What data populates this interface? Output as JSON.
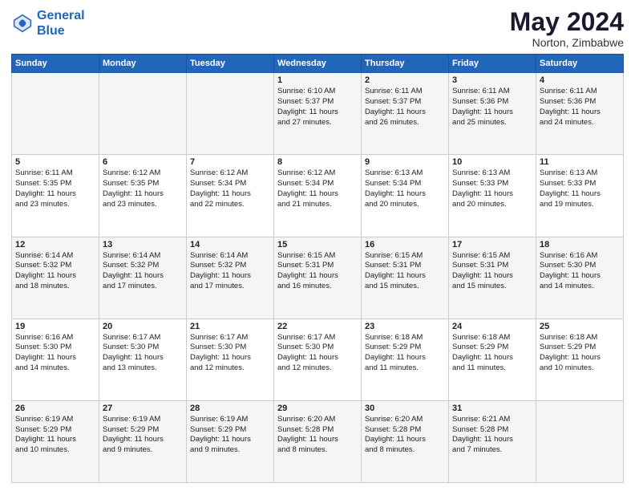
{
  "header": {
    "logo_line1": "General",
    "logo_line2": "Blue",
    "month": "May 2024",
    "location": "Norton, Zimbabwe"
  },
  "weekdays": [
    "Sunday",
    "Monday",
    "Tuesday",
    "Wednesday",
    "Thursday",
    "Friday",
    "Saturday"
  ],
  "weeks": [
    [
      {
        "day": "",
        "content": ""
      },
      {
        "day": "",
        "content": ""
      },
      {
        "day": "",
        "content": ""
      },
      {
        "day": "1",
        "content": "Sunrise: 6:10 AM\nSunset: 5:37 PM\nDaylight: 11 hours\nand 27 minutes."
      },
      {
        "day": "2",
        "content": "Sunrise: 6:11 AM\nSunset: 5:37 PM\nDaylight: 11 hours\nand 26 minutes."
      },
      {
        "day": "3",
        "content": "Sunrise: 6:11 AM\nSunset: 5:36 PM\nDaylight: 11 hours\nand 25 minutes."
      },
      {
        "day": "4",
        "content": "Sunrise: 6:11 AM\nSunset: 5:36 PM\nDaylight: 11 hours\nand 24 minutes."
      }
    ],
    [
      {
        "day": "5",
        "content": "Sunrise: 6:11 AM\nSunset: 5:35 PM\nDaylight: 11 hours\nand 23 minutes."
      },
      {
        "day": "6",
        "content": "Sunrise: 6:12 AM\nSunset: 5:35 PM\nDaylight: 11 hours\nand 23 minutes."
      },
      {
        "day": "7",
        "content": "Sunrise: 6:12 AM\nSunset: 5:34 PM\nDaylight: 11 hours\nand 22 minutes."
      },
      {
        "day": "8",
        "content": "Sunrise: 6:12 AM\nSunset: 5:34 PM\nDaylight: 11 hours\nand 21 minutes."
      },
      {
        "day": "9",
        "content": "Sunrise: 6:13 AM\nSunset: 5:34 PM\nDaylight: 11 hours\nand 20 minutes."
      },
      {
        "day": "10",
        "content": "Sunrise: 6:13 AM\nSunset: 5:33 PM\nDaylight: 11 hours\nand 20 minutes."
      },
      {
        "day": "11",
        "content": "Sunrise: 6:13 AM\nSunset: 5:33 PM\nDaylight: 11 hours\nand 19 minutes."
      }
    ],
    [
      {
        "day": "12",
        "content": "Sunrise: 6:14 AM\nSunset: 5:32 PM\nDaylight: 11 hours\nand 18 minutes."
      },
      {
        "day": "13",
        "content": "Sunrise: 6:14 AM\nSunset: 5:32 PM\nDaylight: 11 hours\nand 17 minutes."
      },
      {
        "day": "14",
        "content": "Sunrise: 6:14 AM\nSunset: 5:32 PM\nDaylight: 11 hours\nand 17 minutes."
      },
      {
        "day": "15",
        "content": "Sunrise: 6:15 AM\nSunset: 5:31 PM\nDaylight: 11 hours\nand 16 minutes."
      },
      {
        "day": "16",
        "content": "Sunrise: 6:15 AM\nSunset: 5:31 PM\nDaylight: 11 hours\nand 15 minutes."
      },
      {
        "day": "17",
        "content": "Sunrise: 6:15 AM\nSunset: 5:31 PM\nDaylight: 11 hours\nand 15 minutes."
      },
      {
        "day": "18",
        "content": "Sunrise: 6:16 AM\nSunset: 5:30 PM\nDaylight: 11 hours\nand 14 minutes."
      }
    ],
    [
      {
        "day": "19",
        "content": "Sunrise: 6:16 AM\nSunset: 5:30 PM\nDaylight: 11 hours\nand 14 minutes."
      },
      {
        "day": "20",
        "content": "Sunrise: 6:17 AM\nSunset: 5:30 PM\nDaylight: 11 hours\nand 13 minutes."
      },
      {
        "day": "21",
        "content": "Sunrise: 6:17 AM\nSunset: 5:30 PM\nDaylight: 11 hours\nand 12 minutes."
      },
      {
        "day": "22",
        "content": "Sunrise: 6:17 AM\nSunset: 5:30 PM\nDaylight: 11 hours\nand 12 minutes."
      },
      {
        "day": "23",
        "content": "Sunrise: 6:18 AM\nSunset: 5:29 PM\nDaylight: 11 hours\nand 11 minutes."
      },
      {
        "day": "24",
        "content": "Sunrise: 6:18 AM\nSunset: 5:29 PM\nDaylight: 11 hours\nand 11 minutes."
      },
      {
        "day": "25",
        "content": "Sunrise: 6:18 AM\nSunset: 5:29 PM\nDaylight: 11 hours\nand 10 minutes."
      }
    ],
    [
      {
        "day": "26",
        "content": "Sunrise: 6:19 AM\nSunset: 5:29 PM\nDaylight: 11 hours\nand 10 minutes."
      },
      {
        "day": "27",
        "content": "Sunrise: 6:19 AM\nSunset: 5:29 PM\nDaylight: 11 hours\nand 9 minutes."
      },
      {
        "day": "28",
        "content": "Sunrise: 6:19 AM\nSunset: 5:29 PM\nDaylight: 11 hours\nand 9 minutes."
      },
      {
        "day": "29",
        "content": "Sunrise: 6:20 AM\nSunset: 5:28 PM\nDaylight: 11 hours\nand 8 minutes."
      },
      {
        "day": "30",
        "content": "Sunrise: 6:20 AM\nSunset: 5:28 PM\nDaylight: 11 hours\nand 8 minutes."
      },
      {
        "day": "31",
        "content": "Sunrise: 6:21 AM\nSunset: 5:28 PM\nDaylight: 11 hours\nand 7 minutes."
      },
      {
        "day": "",
        "content": ""
      }
    ]
  ]
}
